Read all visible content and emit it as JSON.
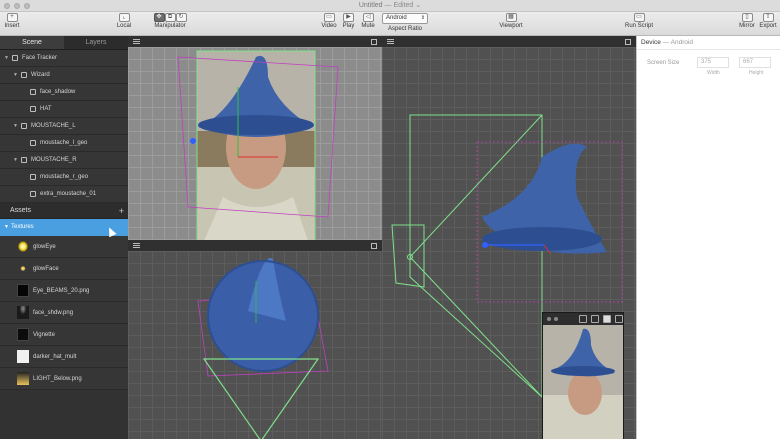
{
  "window": {
    "title": "Untitled",
    "status": "— Edited ⌄"
  },
  "toolbar": {
    "insert": "Insert",
    "local": "Local",
    "manipulator": "Manipulator",
    "video": "Video",
    "play": "Play",
    "mute": "Mute",
    "aspect_ratio_label": "Aspect Ratio",
    "aspect_ratio_value": "Android",
    "viewport": "Viewport",
    "run_script": "Run Script",
    "mirror": "Mirror",
    "export": "Export"
  },
  "left_panel": {
    "tabs": [
      "Scene",
      "Layers"
    ],
    "scene_items": [
      {
        "label": "Face Tracker",
        "indent": 0,
        "icon": "face-tracker-icon",
        "expanded": true
      },
      {
        "label": "Wizard",
        "indent": 1,
        "icon": "null-object-icon",
        "expanded": true
      },
      {
        "label": "face_shadow",
        "indent": 2,
        "icon": "face-mesh-icon",
        "expanded": false
      },
      {
        "label": "HAT",
        "indent": 2,
        "icon": "mesh-icon",
        "expanded": false
      },
      {
        "label": "MOUSTACHE_L",
        "indent": 1,
        "icon": "null-object-icon",
        "expanded": true
      },
      {
        "label": "moustache_l_geo",
        "indent": 2,
        "icon": "mesh-icon",
        "expanded": false
      },
      {
        "label": "MOUSTACHE_R",
        "indent": 1,
        "icon": "null-object-icon",
        "expanded": true
      },
      {
        "label": "moustache_r_geo",
        "indent": 2,
        "icon": "mesh-icon",
        "expanded": false
      },
      {
        "label": "extra_moustache_01",
        "indent": 2,
        "icon": "mesh-icon",
        "expanded": false
      }
    ],
    "assets_label": "Assets",
    "textures_label": "Textures",
    "textures": [
      {
        "label": "glowEye",
        "thumb": "glow-yellow"
      },
      {
        "label": "glowFace",
        "thumb": "glow-dot"
      },
      {
        "label": "Eye_BEAMS_20.png",
        "thumb": "black"
      },
      {
        "label": "face_shdw.png",
        "thumb": "shadow"
      },
      {
        "label": "Vignette",
        "thumb": "vignette"
      },
      {
        "label": "darker_hat_mult",
        "thumb": "white"
      },
      {
        "label": "LIGHT_Below.png",
        "thumb": "gradient"
      }
    ]
  },
  "inspector": {
    "title": "Device",
    "subtitle": "— Android",
    "screen_size_label": "Screen Size",
    "width_value": "375",
    "height_value": "667",
    "width_label": "Width",
    "height_label": "Height"
  },
  "colors": {
    "selection": "#4a9fe0",
    "frustum": "#7fe08a",
    "bounds": "#c040c0"
  }
}
